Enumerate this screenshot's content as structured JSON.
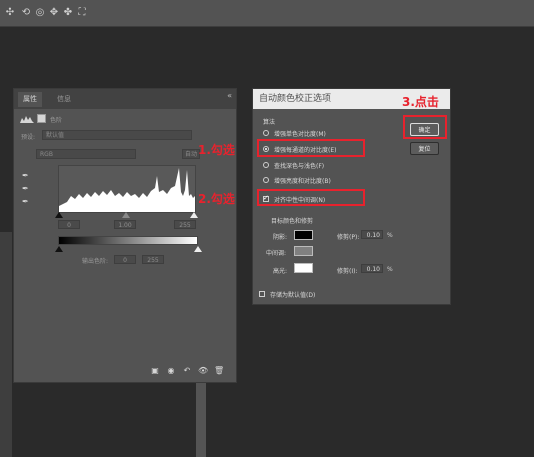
{
  "properties_panel": {
    "tabs": [
      "属性",
      "信息"
    ],
    "close_glyph": "«",
    "preset_label": "预设:",
    "preset_value": "默认值",
    "channel_value": "RGB",
    "auto_label": "自动",
    "input_values": [
      "0",
      "1.00",
      "255"
    ],
    "output_label": "输出色阶:",
    "output_values": [
      "0",
      "255"
    ]
  },
  "dialog": {
    "title": "自动颜色校正选项",
    "algorithm_label": "算法",
    "algorithms": [
      {
        "label": "增强单色对比度(M)",
        "selected": false
      },
      {
        "label": "增强每通道的对比度(E)",
        "selected": true
      },
      {
        "label": "查找深色与浅色(F)",
        "selected": false
      },
      {
        "label": "增强亮度和对比度(B)",
        "selected": false
      }
    ],
    "snap_neutral_label": "对齐中性中间调(N)",
    "snap_neutral_checked": true,
    "targets_label": "目标颜色和修剪",
    "shadows_label": "阴影:",
    "midtones_label": "中间调:",
    "highlights_label": "高光:",
    "clip_label": "修剪(P):",
    "clip_label_2": "修剪(I):",
    "shadow_clip": "0.10",
    "highlight_clip": "0.10",
    "percent": "%",
    "save_default_label": "存储为默认值(D)",
    "ok_button": "确定",
    "cancel_button": "复位",
    "colors": {
      "shadow": "#000000",
      "midtone": "#808080",
      "highlight": "#ffffff"
    }
  },
  "annotations": {
    "step1": "1.勾选",
    "step2": "2.勾选",
    "step3": "3.点击",
    "color": "#e8222d"
  },
  "icons": [
    "move-icon",
    "rotate-icon",
    "orbit-icon",
    "pan-icon",
    "slide-icon",
    "scale-icon",
    "eyedropper-icon",
    "clip-to-layer-icon",
    "visibility-icon",
    "reset-icon",
    "delete-icon"
  ]
}
